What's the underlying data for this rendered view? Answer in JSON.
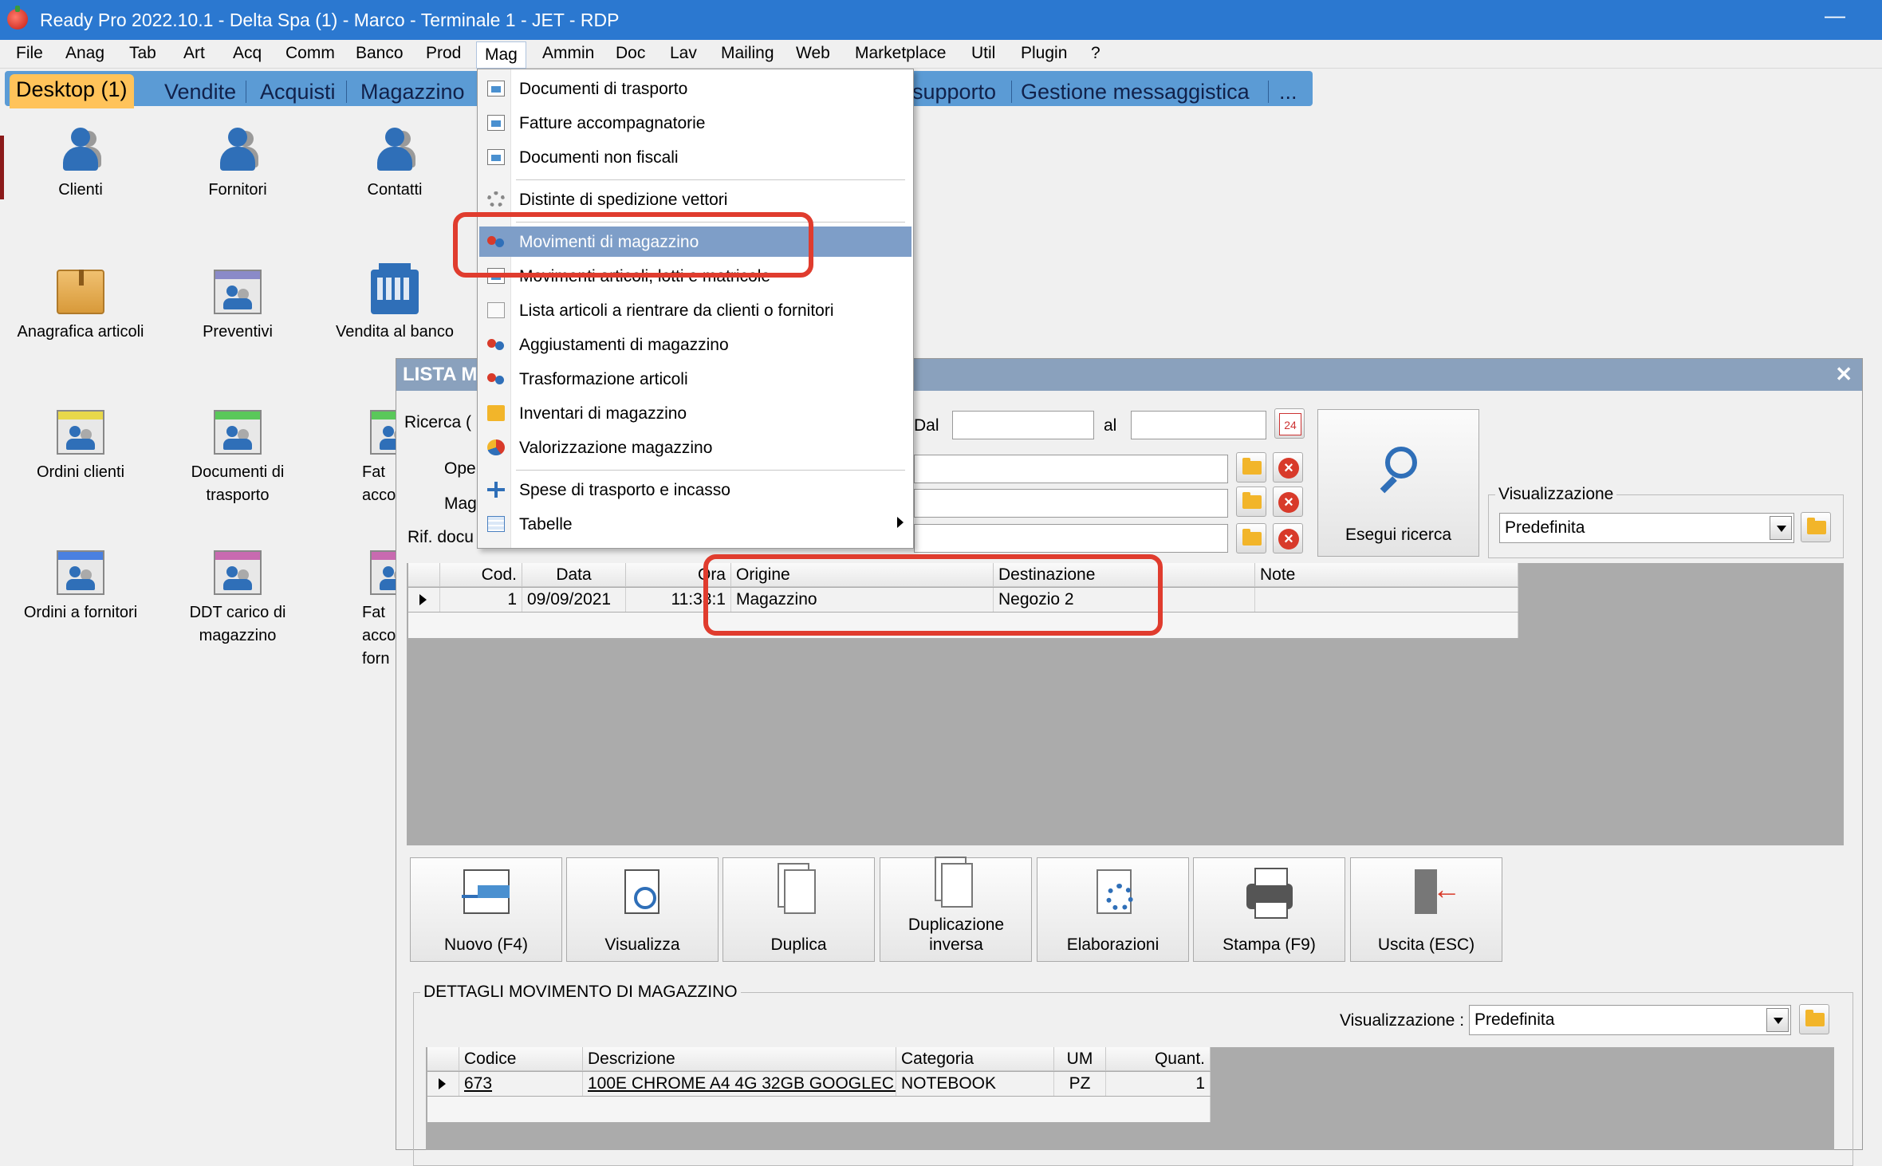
{
  "window": {
    "title": "Ready Pro 2022.10.1 - Delta Spa (1) - Marco - Terminale 1 - JET - RDP",
    "minimize": "—"
  },
  "menubar": [
    "File",
    "Anag",
    "Tab",
    "Art",
    "Acq",
    "Comm",
    "Banco",
    "Prod",
    "Mag",
    "Ammin",
    "Doc",
    "Lav",
    "Mailing",
    "Web",
    "Marketplace",
    "Util",
    "Plugin",
    "?"
  ],
  "tabs": [
    "Desktop (1)",
    "Vendite",
    "Acquisti",
    "Magazzino",
    "supporto",
    "Gestione messaggistica",
    "..."
  ],
  "desktop": {
    "icons": [
      "Clienti",
      "Fornitori",
      "Contatti",
      "Anagrafica articoli",
      "Preventivi",
      "Vendita al banco",
      "Ordini clienti",
      "Documenti di trasporto",
      "Fat accompa",
      "Ordini a fornitori",
      "DDT carico di magazzino",
      "Fat accompa forn"
    ]
  },
  "dropdown": {
    "items": [
      "Documenti di trasporto",
      "Fatture accompagnatorie",
      "Documenti non fiscali",
      "Distinte di spedizione vettori",
      "Movimenti di magazzino",
      "Movimenti articoli, lotti e matricole",
      "Lista articoli a rientrare da clienti o fornitori",
      "Aggiustamenti di magazzino",
      "Trasformazione articoli",
      "Inventari di magazzino",
      "Valorizzazione magazzino",
      "Spese di trasporto e incasso",
      "Tabelle"
    ]
  },
  "dialog": {
    "title": "LISTA M",
    "close": "✕",
    "labels": {
      "ricerca": "Ricerca (",
      "ope": "Ope",
      "mag": "Mag",
      "rif": "Rif. docu",
      "dal": "Dal",
      "al": "al"
    },
    "cal_icon": "24",
    "search_button": "Esegui ricerca",
    "view_group": {
      "legend": "Visualizzazione",
      "value": "Predefinita"
    },
    "grid": {
      "headers": [
        "Cod.",
        "Data",
        "Ora",
        "Origine",
        "Destinazione",
        "Note"
      ],
      "row": [
        "1",
        "09/09/2021",
        "11:33:1",
        "Magazzino",
        "Negozio 2",
        ""
      ]
    },
    "toolbar": [
      "Nuovo (F4)",
      "Visualizza",
      "Duplica",
      "Duplicazione inversa",
      "Elaborazioni",
      "Stampa (F9)",
      "Uscita (ESC)"
    ],
    "details": {
      "legend": "DETTAGLI MOVIMENTO DI MAGAZZINO",
      "view_label": "Visualizzazione :",
      "view_value": "Predefinita",
      "headers": [
        "Codice",
        "Descrizione",
        "Categoria",
        "UM",
        "Quant."
      ],
      "row": [
        "673",
        "100E CHROME A4 4G 32GB GOOGLEC...",
        "NOTEBOOK",
        "PZ",
        "1"
      ]
    }
  },
  "colors": {
    "titlebar": "#2b78d0",
    "tabstrip": "#5b9bd5",
    "active_tab": "#ffc35a",
    "menu_highlight": "#7e9ec8",
    "annotation": "#e03c2e"
  }
}
